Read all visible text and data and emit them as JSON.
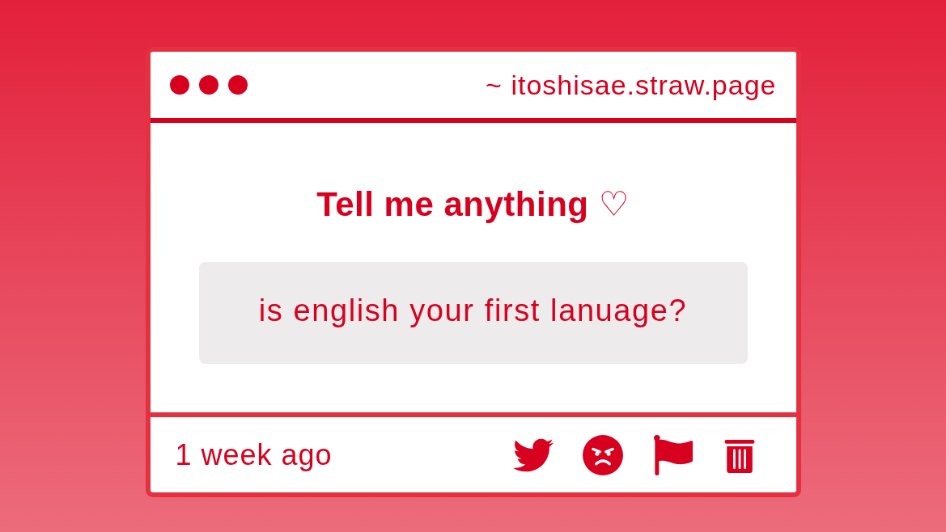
{
  "window": {
    "url": "~ itoshisae.straw.page"
  },
  "prompt": {
    "title": "Tell me anything ♡"
  },
  "message": {
    "text": "is english your first lanuage?"
  },
  "footer": {
    "time": "1 week ago"
  }
}
